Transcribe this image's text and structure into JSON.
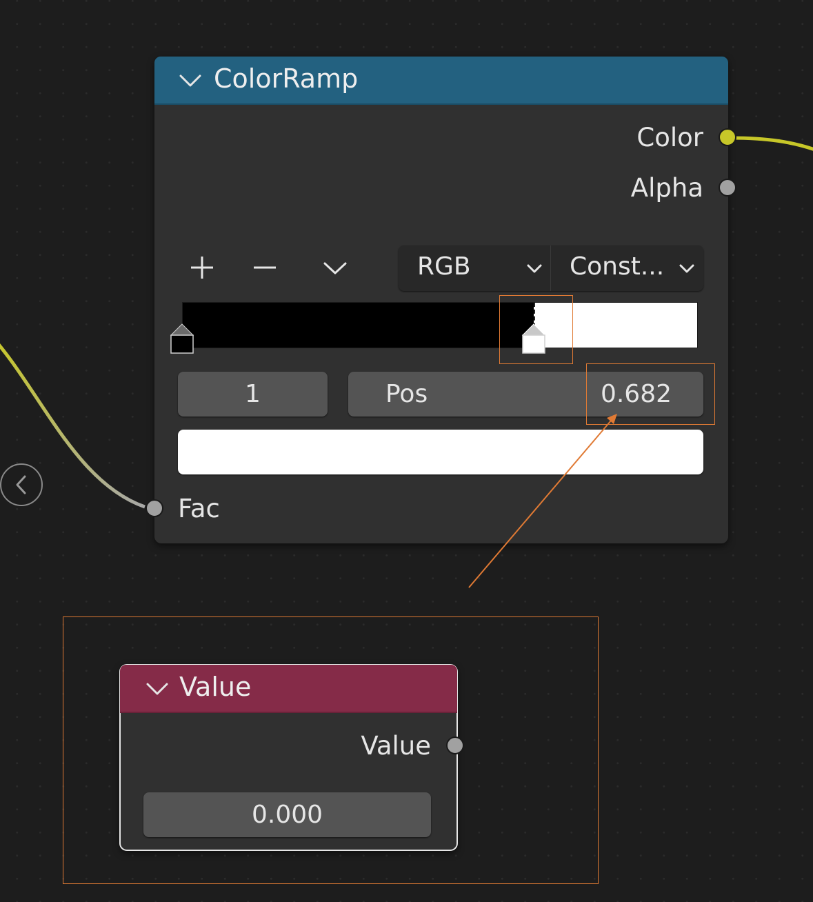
{
  "colorramp_node": {
    "title": "ColorRamp",
    "outputs": {
      "color": "Color",
      "alpha": "Alpha"
    },
    "toolbar": {
      "add": "+",
      "remove": "−"
    },
    "color_mode": "RGB",
    "interpolation": "Const...",
    "stop_index": "1",
    "pos_label": "Pos",
    "pos_value": "0.682",
    "stop_color": "#ffffff",
    "gradient": {
      "left_color": "#000000",
      "right_color": "#ffffff",
      "active_stop_position": 0.682
    },
    "input": {
      "fac": "Fac"
    },
    "header_color": "#236180"
  },
  "value_node": {
    "title": "Value",
    "output": "Value",
    "value": "0.000",
    "header_color": "#852b48"
  },
  "colors": {
    "background": "#1d1d1d",
    "node_body": "#303030",
    "socket_color": "#c7c729",
    "socket_float": "#a1a1a1",
    "annotation": "#e07a34"
  },
  "icons": {
    "header_collapse": "chevron-down-icon",
    "add_stop": "plus-icon",
    "remove_stop": "minus-icon",
    "ramp_menu": "chevron-down-icon",
    "sidebar_toggle": "chevron-left-icon"
  }
}
